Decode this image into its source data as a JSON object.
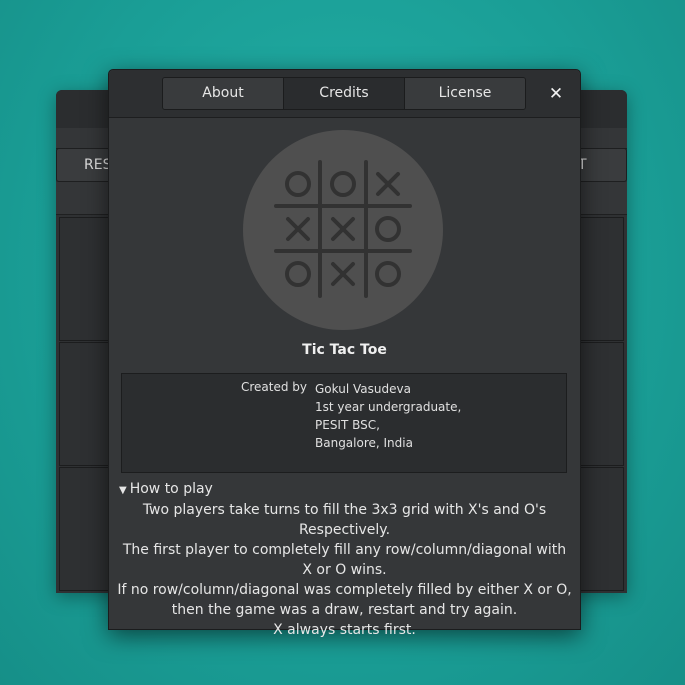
{
  "background_window": {
    "left_button_label": "RES",
    "right_button_label": "T"
  },
  "dialog": {
    "tabs": [
      {
        "label": "About",
        "active": false
      },
      {
        "label": "Credits",
        "active": true
      },
      {
        "label": "License",
        "active": false
      }
    ],
    "close_icon": "close-icon",
    "app_name": "Tic Tac Toe",
    "credits": {
      "created_by_label": "Created by",
      "lines": [
        "Gokul Vasudeva",
        "1st year undergraduate,",
        "PESIT BSC,",
        "Bangalore, India"
      ]
    },
    "how_to_play": {
      "header": "How to play",
      "lines": [
        "Two players take turns to fill the 3x3 grid with X's and O's Respectively.",
        "The first player to completely fill any row/column/diagonal with",
        "X or O wins.",
        "If no row/column/diagonal was completely filled by either X or O,",
        "then the game was a draw, restart and try again.",
        "X always starts first."
      ]
    },
    "logo": {
      "board": [
        [
          "O",
          "O",
          "X"
        ],
        [
          "X",
          "X",
          "O"
        ],
        [
          "O",
          "X",
          "O"
        ]
      ]
    }
  },
  "colors": {
    "desktop": "#1fa8a0",
    "dialog_bg": "#353739",
    "logo_circle": "#4f4f4f",
    "logo_marks": "#323232"
  }
}
